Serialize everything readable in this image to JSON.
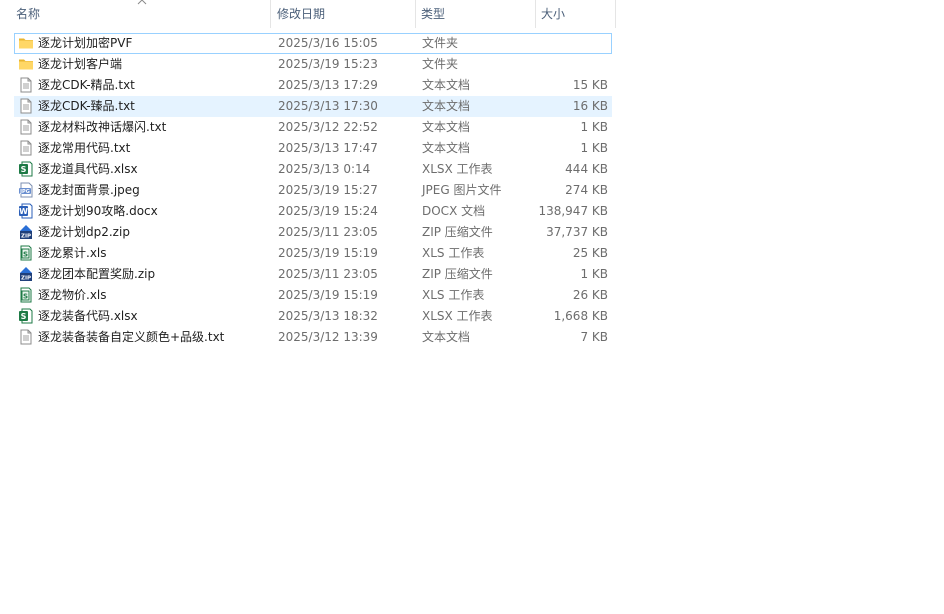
{
  "columns": {
    "name": "名称",
    "date": "修改日期",
    "type": "类型",
    "size": "大小"
  },
  "files": [
    {
      "name": "逐龙计划加密PVF",
      "date": "2025/3/16 15:05",
      "type": "文件夹",
      "size": "",
      "icon": "folder-icon",
      "state": "focused"
    },
    {
      "name": "逐龙计划客户端",
      "date": "2025/3/19 15:23",
      "type": "文件夹",
      "size": "",
      "icon": "folder-icon",
      "state": ""
    },
    {
      "name": "逐龙CDK-精品.txt",
      "date": "2025/3/13 17:29",
      "type": "文本文档",
      "size": "15 KB",
      "icon": "text-file-icon",
      "state": ""
    },
    {
      "name": "逐龙CDK-臻品.txt",
      "date": "2025/3/13 17:30",
      "type": "文本文档",
      "size": "16 KB",
      "icon": "text-file-icon",
      "state": "selected"
    },
    {
      "name": "逐龙材料改神话爆闪.txt",
      "date": "2025/3/12 22:52",
      "type": "文本文档",
      "size": "1 KB",
      "icon": "text-file-icon",
      "state": ""
    },
    {
      "name": "逐龙常用代码.txt",
      "date": "2025/3/13 17:47",
      "type": "文本文档",
      "size": "1 KB",
      "icon": "text-file-icon",
      "state": ""
    },
    {
      "name": "逐龙道具代码.xlsx",
      "date": "2025/3/13 0:14",
      "type": "XLSX 工作表",
      "size": "444 KB",
      "icon": "xlsx-icon",
      "state": ""
    },
    {
      "name": "逐龙封面背景.jpeg",
      "date": "2025/3/19 15:27",
      "type": "JPEG 图片文件",
      "size": "274 KB",
      "icon": "jpeg-icon",
      "state": ""
    },
    {
      "name": "逐龙计划90攻略.docx",
      "date": "2025/3/19 15:24",
      "type": "DOCX 文档",
      "size": "138,947 KB",
      "icon": "docx-icon",
      "state": ""
    },
    {
      "name": "逐龙计划dp2.zip",
      "date": "2025/3/11 23:05",
      "type": "ZIP 压缩文件",
      "size": "37,737 KB",
      "icon": "zip-icon",
      "state": ""
    },
    {
      "name": "逐龙累计.xls",
      "date": "2025/3/19 15:19",
      "type": "XLS 工作表",
      "size": "25 KB",
      "icon": "xls-icon",
      "state": ""
    },
    {
      "name": "逐龙团本配置奖励.zip",
      "date": "2025/3/11 23:05",
      "type": "ZIP 压缩文件",
      "size": "1 KB",
      "icon": "zip-icon",
      "state": ""
    },
    {
      "name": "逐龙物价.xls",
      "date": "2025/3/19 15:19",
      "type": "XLS 工作表",
      "size": "26 KB",
      "icon": "xls-icon",
      "state": ""
    },
    {
      "name": "逐龙装备代码.xlsx",
      "date": "2025/3/13 18:32",
      "type": "XLSX 工作表",
      "size": "1,668 KB",
      "icon": "xlsx-icon",
      "state": ""
    },
    {
      "name": "逐龙装备装备自定义颜色+品级.txt",
      "date": "2025/3/12 13:39",
      "type": "文本文档",
      "size": "7 KB",
      "icon": "text-file-icon",
      "state": ""
    }
  ],
  "colors": {
    "header_text": "#4c607a",
    "selected_bg": "#e5f3ff",
    "focus_border": "#99d1ff",
    "folder": "#ffd766",
    "excel_green": "#1d7a45",
    "word_blue": "#2b5fb8",
    "zip_blue": "#2a6fd6"
  }
}
